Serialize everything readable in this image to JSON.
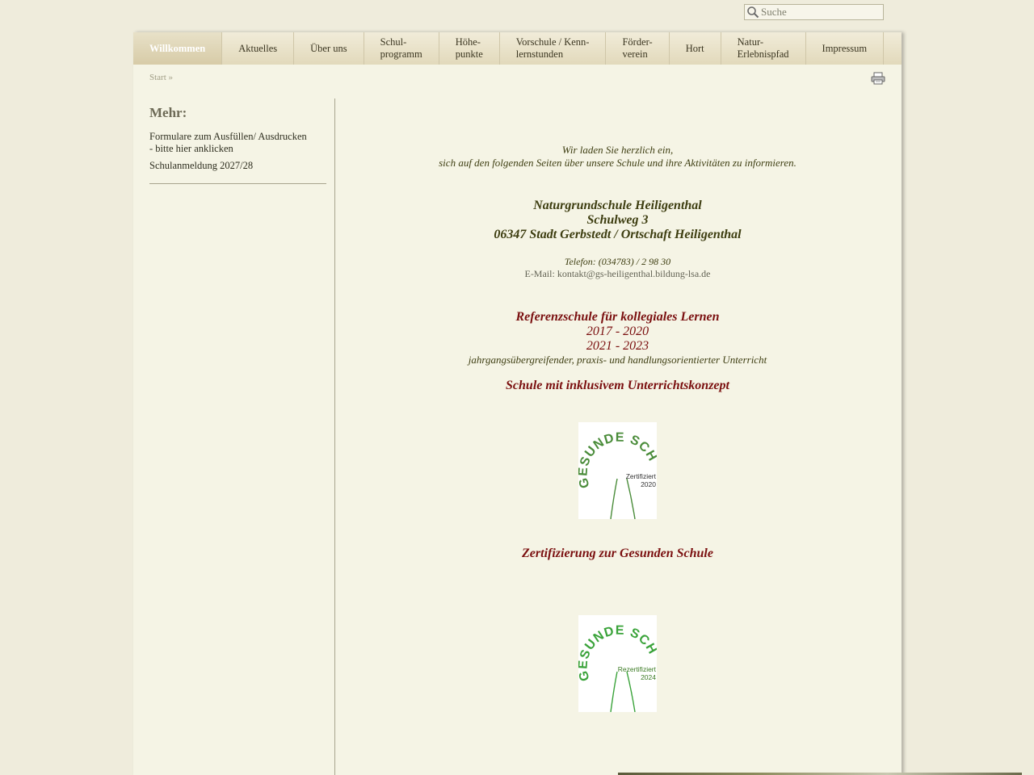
{
  "search": {
    "placeholder": "Suche",
    "icon": "magnifier-icon"
  },
  "nav": {
    "items": [
      {
        "label": "Willkommen",
        "active": true
      },
      {
        "label": "Aktuelles",
        "active": false
      },
      {
        "label": "Über uns",
        "active": false
      },
      {
        "label": "Schul-\nprogramm",
        "active": false
      },
      {
        "label": "Höhe-\npunkte",
        "active": false
      },
      {
        "label": "Vorschule / Kenn-\nlernstunden",
        "active": false
      },
      {
        "label": "Förder-\nverein",
        "active": false
      },
      {
        "label": "Hort",
        "active": false
      },
      {
        "label": "Natur-\nErlebnispfad",
        "active": false
      },
      {
        "label": "Impressum",
        "active": false
      }
    ]
  },
  "breadcrumb": "Start »",
  "sidebar": {
    "heading": "Mehr:",
    "links": [
      "Formulare zum Ausfüllen/ Ausdrucken\n- bitte hier anklicken",
      "Schulanmeldung 2027/28"
    ]
  },
  "content": {
    "intro_line1": "Wir laden Sie herzlich ein,",
    "intro_line2": "sich auf den folgenden Seiten über unsere Schule und ihre Aktivitäten zu informieren.",
    "address_name": "Naturgrundschule Heiligenthal",
    "address_street": "Schulweg 3",
    "address_city": "06347 Stadt Gerbstedt / Ortschaft Heiligenthal",
    "phone": "Telefon: (034783) / 2 98 30",
    "email_label": "E-Mail: ",
    "email": "kontakt@gs-heiligenthal.bildung-lsa.de",
    "ref_title": "Referenzschule für kollegiales Lernen",
    "ref_period1": "2017 - 2020",
    "ref_period2": "2021 - 2023",
    "ref_sub": "jahrgangsübergreifender, praxis- und handlungsorientierter Unterricht",
    "inclusive": "Schule mit inklusivem Unterrichtskonzept",
    "logo1": {
      "text_top": "GESUNDE SCHULE",
      "text_small1": "Zertifiziert",
      "text_small2": "2020",
      "color": "#4a8c3a"
    },
    "certification": "Zertifizierung zur Gesunden Schule",
    "logo2": {
      "text_top": "GESUNDE SCHULE",
      "text_small1": "Rezertifiziert",
      "text_small2": "2024",
      "color": "#3aa33a"
    }
  },
  "colors": {
    "background": "#efecdc",
    "page": "#f5f4e5",
    "accent_red": "#7a0f0f",
    "text_olive": "#3d3d10"
  }
}
